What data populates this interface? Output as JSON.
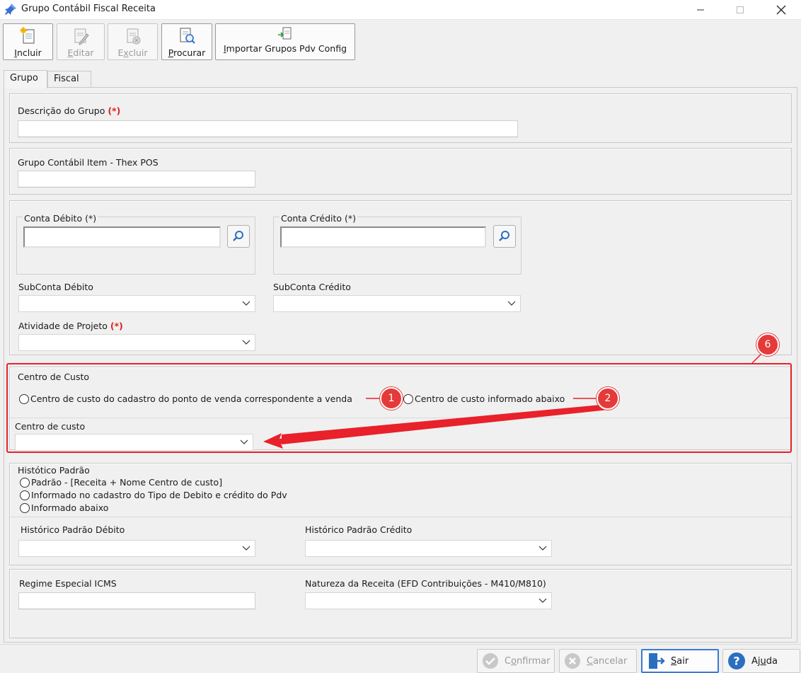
{
  "window": {
    "title": "Grupo Contábil Fiscal Receita",
    "minimize_icon": "minimize-icon",
    "maximize_icon": "maximize-icon",
    "close_icon": "close-icon"
  },
  "toolbar": {
    "incluir": {
      "pre": "",
      "ul": "I",
      "post": "ncluir",
      "enabled": true
    },
    "editar": {
      "pre": "",
      "ul": "E",
      "post": "ditar",
      "enabled": false
    },
    "excluir": {
      "pre": "E",
      "ul": "x",
      "post": "cluir",
      "enabled": false
    },
    "procurar": {
      "pre": "",
      "ul": "P",
      "post": "rocurar",
      "enabled": true
    },
    "importar": {
      "pre": "",
      "ul": "I",
      "post": "mportar Grupos Pdv Config",
      "enabled": true
    }
  },
  "tabs": [
    "Grupo",
    "Fiscal"
  ],
  "form": {
    "descricao_label": "Descrição do Grupo",
    "required_mark": "(*)",
    "descricao_value": "",
    "grupo_item_label": "Grupo Contábil Item - Thex POS",
    "grupo_item_value": "",
    "conta_debito_label": "Conta Débito (*)",
    "conta_debito_value": "",
    "conta_credito_label": "Conta Crédito (*)",
    "conta_credito_value": "",
    "subconta_debito_label": "SubConta Débito",
    "subconta_debito_value": "",
    "subconta_credito_label": "SubConta Crédito",
    "subconta_credito_value": "",
    "atividade_label": "Atividade de Projeto",
    "atividade_value": "",
    "centro_custo_group_label": "Centro de Custo",
    "centro_custo_opt1": "Centro de custo do cadastro do ponto de venda correspondente a venda",
    "centro_custo_opt2": "Centro de custo informado abaixo",
    "centro_custo_combo_label": "Centro de custo",
    "centro_custo_value": "",
    "historico_group_label": "Histótico Padrão",
    "historico_opt1": "Padrão - [Receita + Nome Centro de custo]",
    "historico_opt2": "Informado no cadastro do Tipo de Debito e crédito do Pdv",
    "historico_opt3": "Informado abaixo",
    "historico_debito_label": "Histórico Padrão Débito",
    "historico_credito_label": "Histórico Padrão Crédito",
    "regime_label": "Regime Especial ICMS",
    "regime_value": "",
    "natureza_label": "Natureza da Receita (EFD Contribuições - M410/M810)"
  },
  "annotations": {
    "badge_1": "1",
    "badge_2": "2",
    "badge_6": "6",
    "color": "#e8212a"
  },
  "bottom": {
    "confirmar": {
      "pre": "C",
      "ul": "o",
      "post": "nfirmar",
      "enabled": false
    },
    "cancelar": {
      "pre": "",
      "ul": "C",
      "post": "ancelar",
      "enabled": false
    },
    "sair": {
      "pre": "",
      "ul": "S",
      "post": "air",
      "enabled": true
    },
    "ajuda": {
      "pre": "Aj",
      "ul": "u",
      "post": "da",
      "enabled": true
    }
  },
  "colors": {
    "accent_blue": "#2c6fbf",
    "required_red": "#e02020",
    "annotation_red": "#e8212a"
  }
}
